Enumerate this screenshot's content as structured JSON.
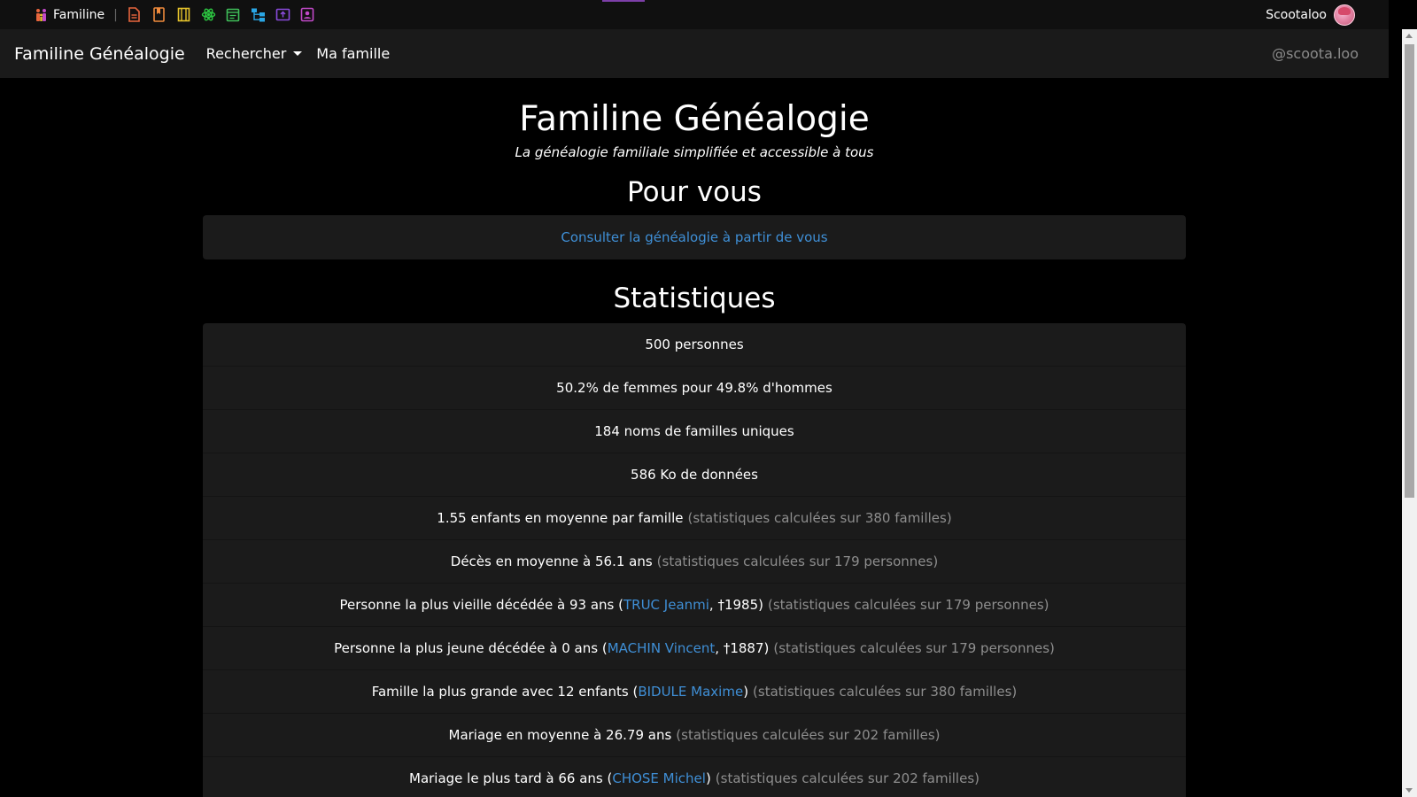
{
  "appbar": {
    "brand_label": "Familine",
    "separator": "|",
    "icons": [
      {
        "name": "document-icon",
        "color": "#e8663d"
      },
      {
        "name": "bookmark-icon",
        "color": "#ef8a3c"
      },
      {
        "name": "book-icon",
        "color": "#e7c42c"
      },
      {
        "name": "atom-icon",
        "color": "#2cc541"
      },
      {
        "name": "calendar-icon",
        "color": "#3fbf5a"
      },
      {
        "name": "tree-icon",
        "color": "#2aa6e5"
      },
      {
        "name": "upload-icon",
        "color": "#8a4bdc"
      },
      {
        "name": "contact-icon",
        "color": "#c249c9"
      }
    ],
    "user_name": "Scootaloo"
  },
  "navbar": {
    "brand": "Familine Généalogie",
    "search_label": "Rechercher",
    "family_label": "Ma famille",
    "handle": "@scoota.loo"
  },
  "header": {
    "title": "Familine Généalogie",
    "tagline": "La généalogie familiale simplifiée et accessible à tous"
  },
  "for_you": {
    "title": "Pour vous",
    "link": "Consulter la généalogie à partir de vous"
  },
  "stats": {
    "title": "Statistiques",
    "rows": [
      {
        "text": "500 personnes"
      },
      {
        "text": "50.2% de femmes pour 49.8% d'hommes"
      },
      {
        "text": "184 noms de familles uniques"
      },
      {
        "text": "586 Ko de données"
      },
      {
        "text": "1.55 enfants en moyenne par famille",
        "note": "(statistiques calculées sur 380 familles)"
      },
      {
        "text": "Décès en moyenne à 56.1 ans",
        "note": "(statistiques calculées sur 179 personnes)"
      },
      {
        "text": "Personne la plus vieille décédée à 93 ans (",
        "link": "TRUC Jeanmi",
        "after": ", †1985)",
        "note": "(statistiques calculées sur 179 personnes)"
      },
      {
        "text": "Personne la plus jeune décédée à 0 ans (",
        "link": "MACHIN Vincent",
        "after": ", †1887)",
        "note": "(statistiques calculées sur 179 personnes)"
      },
      {
        "text": "Famille la plus grande avec 12 enfants (",
        "link": "BIDULE Maxime",
        "after": ")",
        "note": "(statistiques calculées sur 380 familles)"
      },
      {
        "text": "Mariage en moyenne à 26.79 ans",
        "note": "(statistiques calculées sur 202 familles)"
      },
      {
        "text": "Mariage le plus tard à 66 ans (",
        "link": "CHOSE Michel",
        "after": ")",
        "note": "(statistiques calculées sur 202 familles)"
      }
    ]
  },
  "colors": {
    "accent_link": "#3f8fd6",
    "muted_text": "#8e8e8e",
    "navbar_bg": "#1a1a1a",
    "card_bg": "#1b1b1b"
  }
}
